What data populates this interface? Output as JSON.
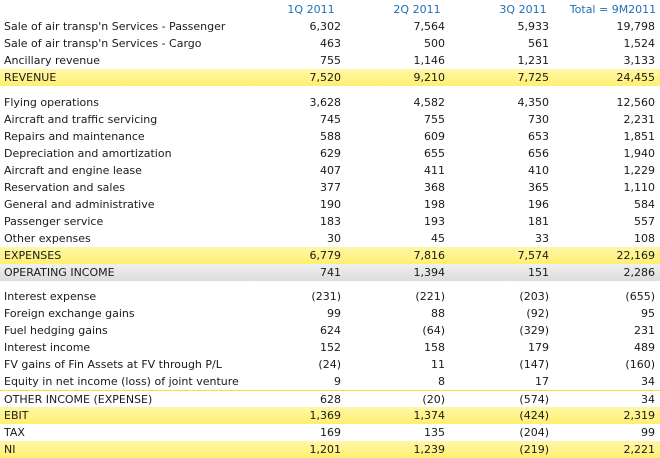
{
  "headers": [
    "1Q 2011",
    "2Q 2011",
    "3Q 2011",
    "Total = 9M2011"
  ],
  "sections": [
    {
      "rows": [
        {
          "label": "Sale of air transp'n Services - Passenger",
          "values": [
            "6,302",
            "7,564",
            "5,933",
            "19,798"
          ],
          "style": "normal"
        },
        {
          "label": "Sale of air transp'n Services - Cargo",
          "values": [
            "463",
            "500",
            "561",
            "1,524"
          ],
          "style": "normal"
        },
        {
          "label": "Ancillary revenue",
          "values": [
            "755",
            "1,146",
            "1,231",
            "3,133"
          ],
          "style": "normal"
        },
        {
          "label": "REVENUE",
          "values": [
            "7,520",
            "9,210",
            "7,725",
            "24,455"
          ],
          "style": "yellow"
        }
      ]
    },
    {
      "rows": [
        {
          "label": "Flying operations",
          "values": [
            "3,628",
            "4,582",
            "4,350",
            "12,560"
          ],
          "style": "normal"
        },
        {
          "label": "Aircraft and traffic servicing",
          "values": [
            "745",
            "755",
            "730",
            "2,231"
          ],
          "style": "normal"
        },
        {
          "label": "Repairs and maintenance",
          "values": [
            "588",
            "609",
            "653",
            "1,851"
          ],
          "style": "normal"
        },
        {
          "label": "Depreciation and amortization",
          "values": [
            "629",
            "655",
            "656",
            "1,940"
          ],
          "style": "normal"
        },
        {
          "label": "Aircraft and engine lease",
          "values": [
            "407",
            "411",
            "410",
            "1,229"
          ],
          "style": "normal"
        },
        {
          "label": "Reservation and sales",
          "values": [
            "377",
            "368",
            "365",
            "1,110"
          ],
          "style": "normal"
        },
        {
          "label": "General and administrative",
          "values": [
            "190",
            "198",
            "196",
            "584"
          ],
          "style": "normal"
        },
        {
          "label": "Passenger service",
          "values": [
            "183",
            "193",
            "181",
            "557"
          ],
          "style": "normal"
        },
        {
          "label": "Other expenses",
          "values": [
            "30",
            "45",
            "33",
            "108"
          ],
          "style": "normal"
        },
        {
          "label": "EXPENSES",
          "values": [
            "6,779",
            "7,816",
            "7,574",
            "22,169"
          ],
          "style": "yellow"
        },
        {
          "label": "OPERATING INCOME",
          "values": [
            "741",
            "1,394",
            "151",
            "2,286"
          ],
          "style": "grey"
        }
      ]
    },
    {
      "rows": [
        {
          "label": "Interest expense",
          "values": [
            "(231)",
            "(221)",
            "(203)",
            "(655)"
          ],
          "style": "normal"
        },
        {
          "label": "Foreign exchange gains",
          "values": [
            "99",
            "88",
            "(92)",
            "95"
          ],
          "style": "normal"
        },
        {
          "label": "Fuel hedging gains",
          "values": [
            "624",
            "(64)",
            "(329)",
            "231"
          ],
          "style": "normal"
        },
        {
          "label": "Interest income",
          "values": [
            "152",
            "158",
            "179",
            "489"
          ],
          "style": "normal"
        },
        {
          "label": "FV gains of Fin Assets at FV through P/L",
          "values": [
            "(24)",
            "11",
            "(147)",
            "(160)"
          ],
          "style": "normal"
        },
        {
          "label": "Equity in net income (loss) of joint venture",
          "values": [
            "9",
            "8",
            "17",
            "34"
          ],
          "style": "normal"
        },
        {
          "label": "OTHER INCOME (EXPENSE)",
          "values": [
            "628",
            "(20)",
            "(574)",
            "34"
          ],
          "style": "line"
        },
        {
          "label": "EBIT",
          "values": [
            "1,369",
            "1,374",
            "(424)",
            "2,319"
          ],
          "style": "yellow"
        },
        {
          "label": "TAX",
          "values": [
            "169",
            "135",
            "(204)",
            "99"
          ],
          "style": "normal"
        },
        {
          "label": "NI",
          "values": [
            "1,201",
            "1,239",
            "(219)",
            "2,221"
          ],
          "style": "yellow"
        }
      ]
    }
  ],
  "colors": {
    "header_text": "#1f6fb8",
    "highlight_yellow": "#fff38a",
    "highlight_grey": "#e4e4e4"
  }
}
